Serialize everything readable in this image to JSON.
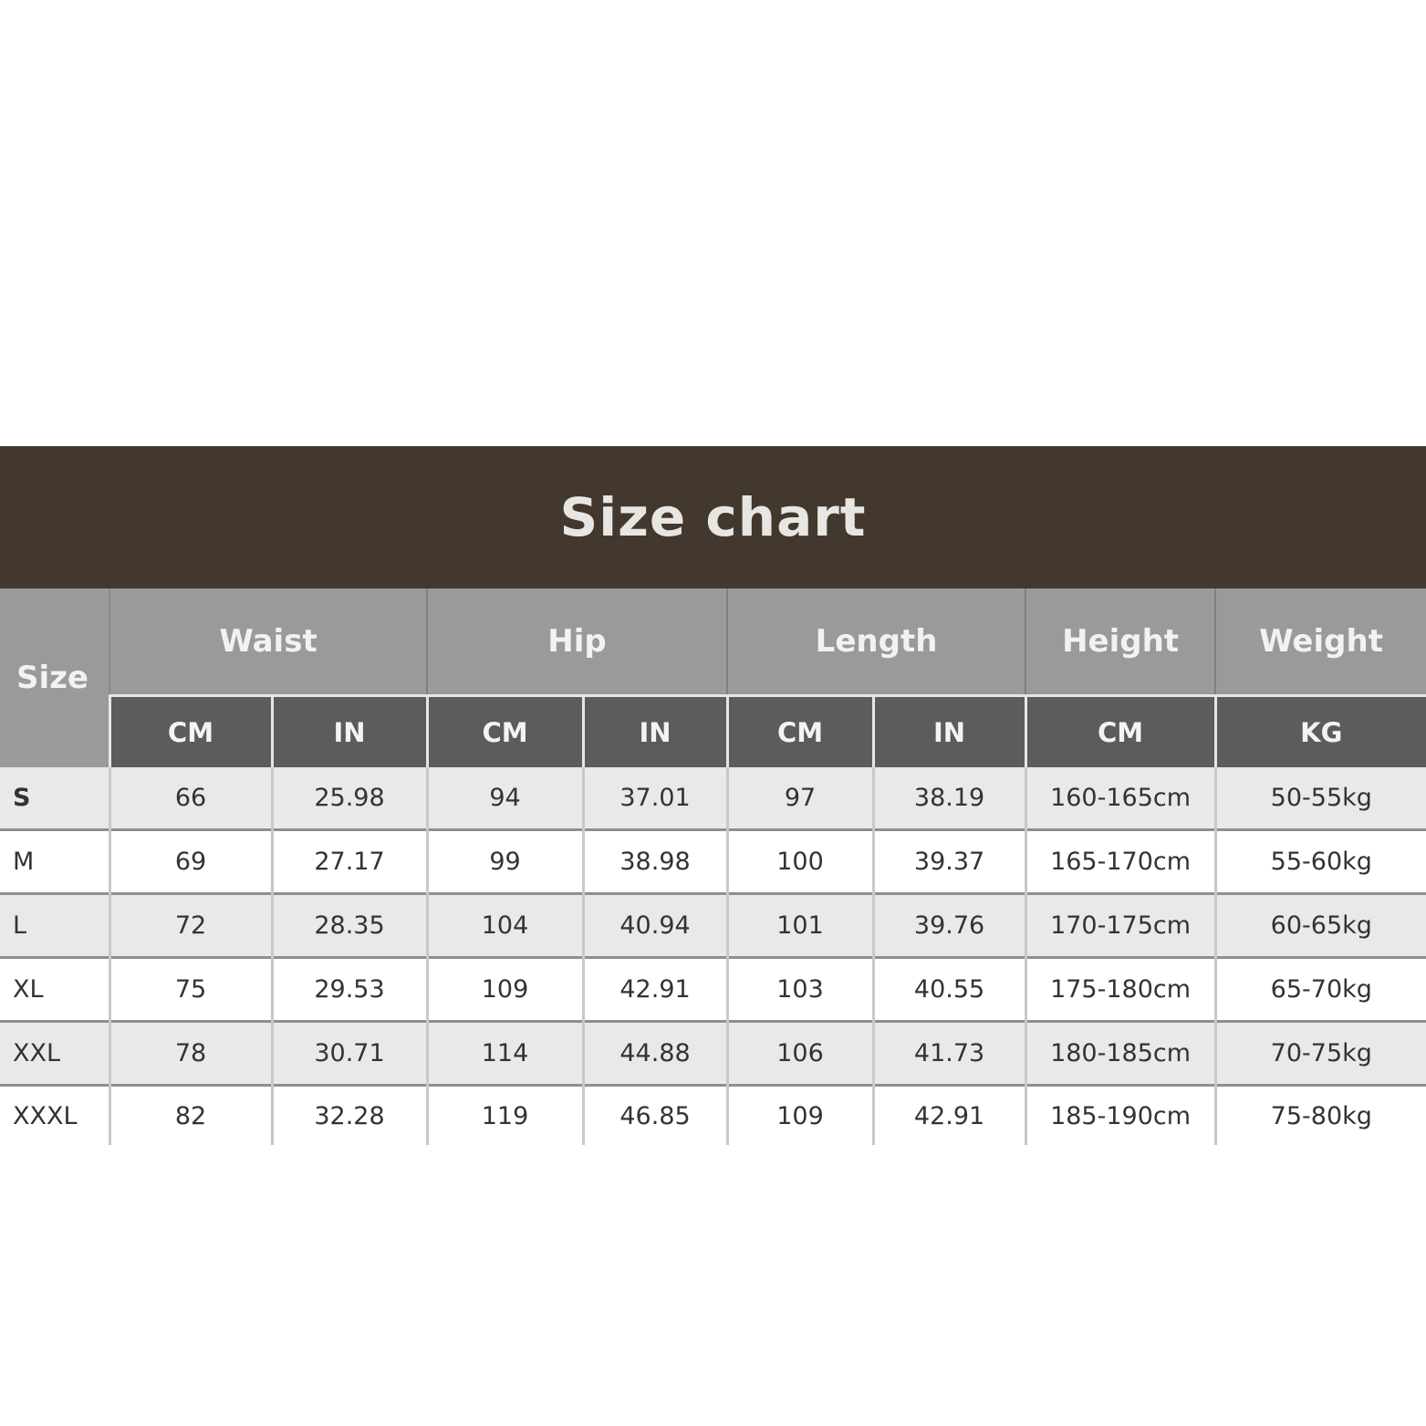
{
  "title": "Size chart",
  "headers": {
    "size": "Size",
    "groups": [
      "Waist",
      "Hip",
      "Length",
      "Height",
      "Weight"
    ],
    "units": [
      "CM",
      "IN",
      "CM",
      "IN",
      "CM",
      "IN",
      "CM",
      "KG"
    ]
  },
  "rows": [
    {
      "size": "S",
      "cells": [
        "66",
        "25.98",
        "94",
        "37.01",
        "97",
        "38.19",
        "160-165cm",
        "50-55kg"
      ]
    },
    {
      "size": "M",
      "cells": [
        "69",
        "27.17",
        "99",
        "38.98",
        "100",
        "39.37",
        "165-170cm",
        "55-60kg"
      ]
    },
    {
      "size": "L",
      "cells": [
        "72",
        "28.35",
        "104",
        "40.94",
        "101",
        "39.76",
        "170-175cm",
        "60-65kg"
      ]
    },
    {
      "size": "XL",
      "cells": [
        "75",
        "29.53",
        "109",
        "42.91",
        "103",
        "40.55",
        "175-180cm",
        "65-70kg"
      ]
    },
    {
      "size": "XXL",
      "cells": [
        "78",
        "30.71",
        "114",
        "44.88",
        "106",
        "41.73",
        "180-185cm",
        "70-75kg"
      ]
    },
    {
      "size": "XXXL",
      "cells": [
        "82",
        "32.28",
        "119",
        "46.85",
        "109",
        "42.91",
        "185-190cm",
        "75-80kg"
      ]
    }
  ],
  "colors": {
    "title_bar": "#43382d",
    "group_header": "#9a9a9a",
    "unit_header": "#5c5c5c",
    "row_shaded": "#e9e9e9"
  }
}
